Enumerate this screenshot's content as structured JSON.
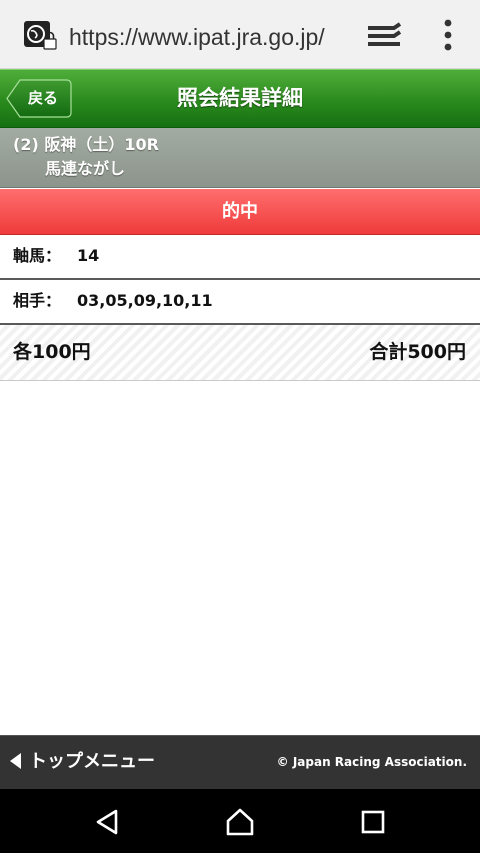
{
  "browser": {
    "url": "https://www.ipat.jra.go.jp/",
    "icons": [
      "site-security-icon",
      "tab-switcher-icon",
      "overflow-menu-icon"
    ]
  },
  "header": {
    "back_label": "戻る",
    "title": "照会結果詳細",
    "color": "#2b8a1d"
  },
  "race": {
    "line1": "(2) 阪神（土）10R",
    "line2": "馬連ながし"
  },
  "result": {
    "status": "的中",
    "color": "#ef3b3b"
  },
  "bet": {
    "axis_label": "軸馬：",
    "axis_value": "14",
    "partner_label": "相手：",
    "partner_value": "03,05,09,10,11",
    "each_amount": "各100円",
    "total_amount": "合計500円"
  },
  "footer": {
    "menu_label": "トップメニュー",
    "copyright": "© Japan Racing Association."
  },
  "android_nav": {
    "icons": [
      "back-icon",
      "home-icon",
      "recent-apps-icon"
    ]
  }
}
